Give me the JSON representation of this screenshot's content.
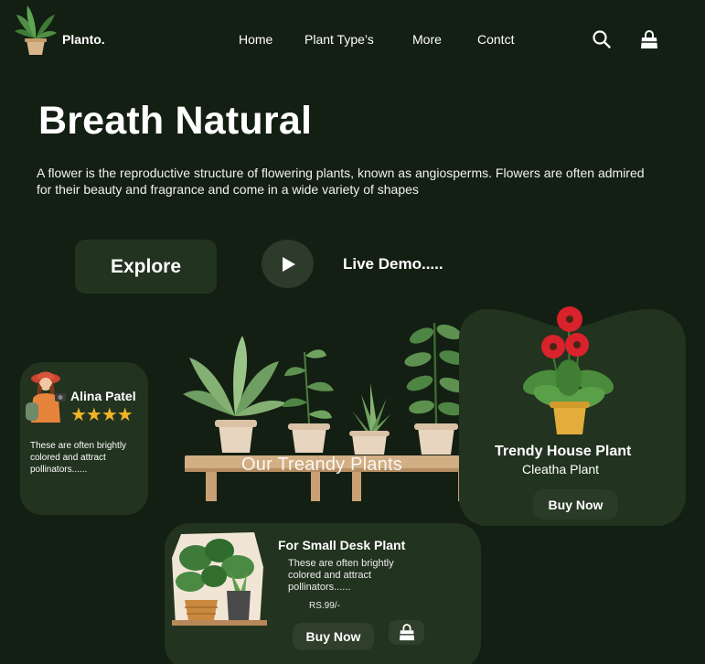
{
  "nav": {
    "brand": "Planto.",
    "links": [
      "Home",
      "Plant Type’s",
      "More",
      "Contct"
    ],
    "icons": [
      "search-icon",
      "shopping-bag-icon"
    ]
  },
  "hero": {
    "title": "Breath Natural",
    "description": "A flower is the reproductive structure of flowering plants, known as angiosperms. Flowers are often admired for their beauty and fragrance and come in a wide variety of shapes",
    "explore_label": "Explore",
    "live_demo_label": "Live Demo....."
  },
  "review": {
    "name": "Alina Patel",
    "stars": "★★★★",
    "text": "These are often brightly colored and attract pollinators......"
  },
  "shelf": {
    "title": "Our Treandy Plants"
  },
  "trendy": {
    "title": "Trendy House Plant",
    "subtitle": "Cleatha Plant",
    "buy_label": "Buy Now"
  },
  "desk": {
    "title": "For Small Desk Plant",
    "text": "These are often brightly colored and attract pollinators......",
    "price": "RS.99/-",
    "buy_label": "Buy Now"
  },
  "colors": {
    "background": "#131f12",
    "card": "#22331f",
    "star": "#f0b429"
  }
}
